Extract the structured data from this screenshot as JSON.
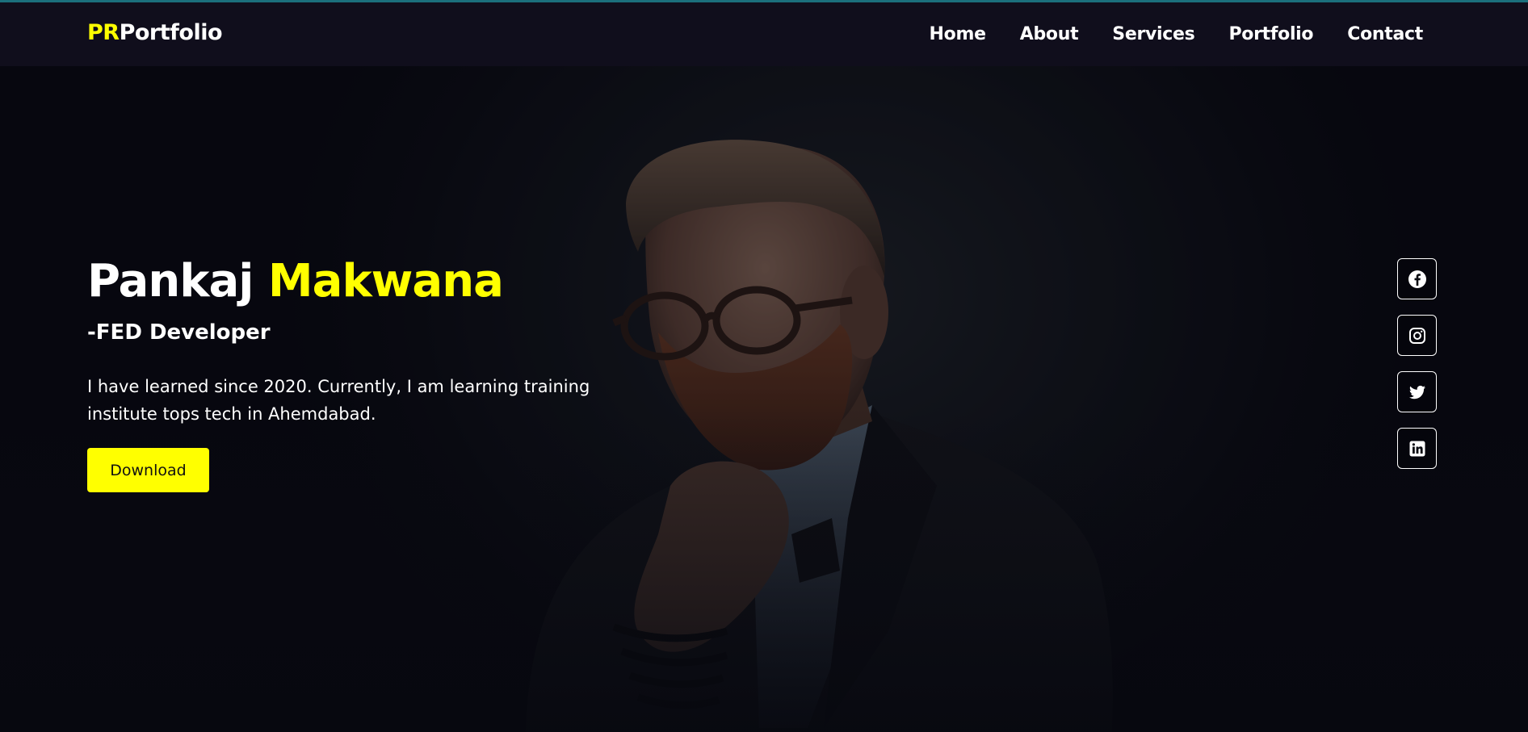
{
  "brand": {
    "prefix": "PR",
    "suffix": "Portfolio"
  },
  "nav": {
    "items": [
      {
        "label": "Home"
      },
      {
        "label": "About"
      },
      {
        "label": "Services"
      },
      {
        "label": "Portfolio"
      },
      {
        "label": "Contact"
      }
    ]
  },
  "hero": {
    "first_name": "Pankaj",
    "last_name": "Makwana",
    "role": "-FED Developer",
    "bio": "I have learned since 2020. Currently, I am learning training institute tops tech in Ahemdabad.",
    "download_label": "Download"
  },
  "socials": {
    "icons": [
      "facebook-icon",
      "instagram-icon",
      "twitter-icon",
      "linkedin-icon"
    ]
  },
  "colors": {
    "accent": "#ffff00",
    "navbar_bg": "#100e1c",
    "page_bg": "#0b0b14",
    "text": "#ffffff"
  }
}
